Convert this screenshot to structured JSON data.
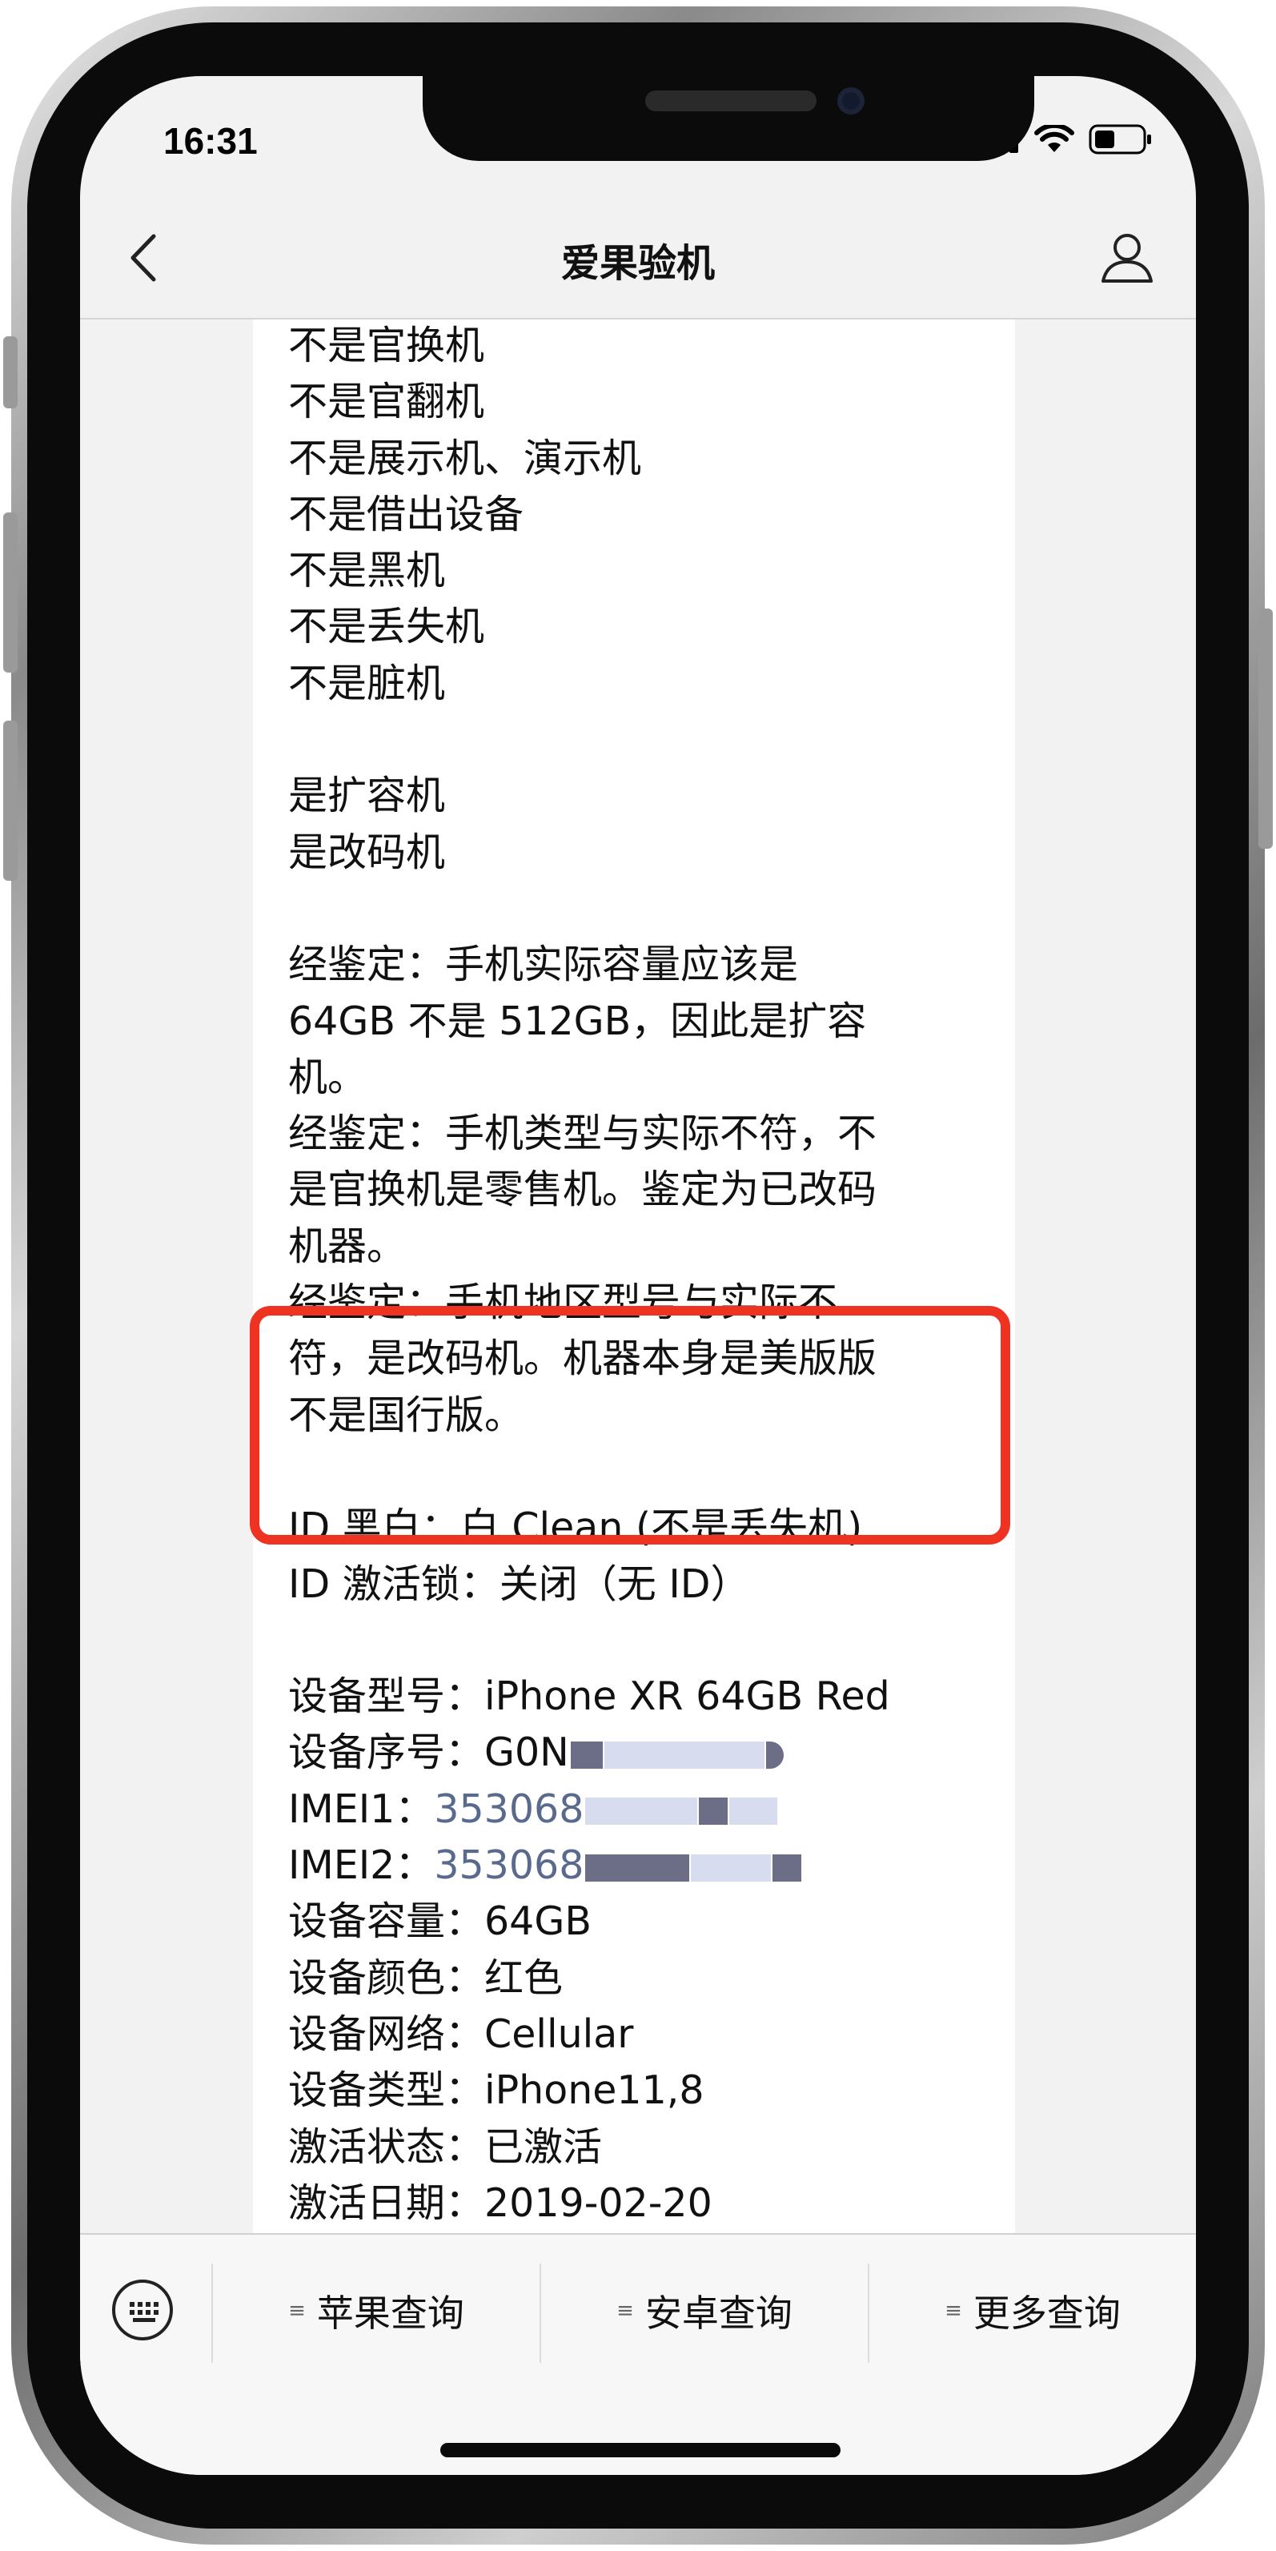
{
  "status": {
    "time": "16:31"
  },
  "nav": {
    "title": "爱果验机"
  },
  "message_lines": [
    "不是官换机",
    "不是官翻机",
    "不是展示机、演示机",
    "不是借出设备",
    "不是黑机",
    "不是丢失机",
    "不是脏机",
    "",
    "是扩容机",
    "是改码机",
    "",
    "经鉴定：手机实际容量应该是",
    "64GB 不是 512GB，因此是扩容",
    "机。",
    "经鉴定：手机类型与实际不符，不",
    "是官换机是零售机。鉴定为已改码",
    "机器。",
    "经鉴定：手机地区型号与实际不",
    "符，是改码机。机器本身是美版版",
    "不是国行版。",
    "",
    "ID 黑白：白 Clean (不是丢失机)",
    "ID 激活锁：关闭（无 ID）",
    ""
  ],
  "device_info": {
    "model": "设备型号：iPhone XR 64GB Red",
    "serial_label": "设备序号：",
    "serial_visible": "G0N",
    "imei1_label": "IMEI1：",
    "imei1_visible": "353068",
    "imei2_label": "IMEI2：",
    "imei2_visible": "353068",
    "capacity": "设备容量：64GB",
    "color": "设备颜色：红色",
    "network": "设备网络：Cellular",
    "type": "设备类型：iPhone11,8",
    "activation_status": "激活状态：已激活",
    "activation_date": "激活日期：2019-02-20"
  },
  "bottom_menu": {
    "items": [
      "苹果查询",
      "安卓查询",
      "更多查询"
    ]
  },
  "colors": {
    "highlight": "#ee3322",
    "imei": "#5a6a8c"
  },
  "icons": [
    "back-chevron-icon",
    "profile-icon",
    "signal-icon",
    "wifi-icon",
    "battery-icon",
    "keyboard-icon",
    "menu-icon"
  ]
}
